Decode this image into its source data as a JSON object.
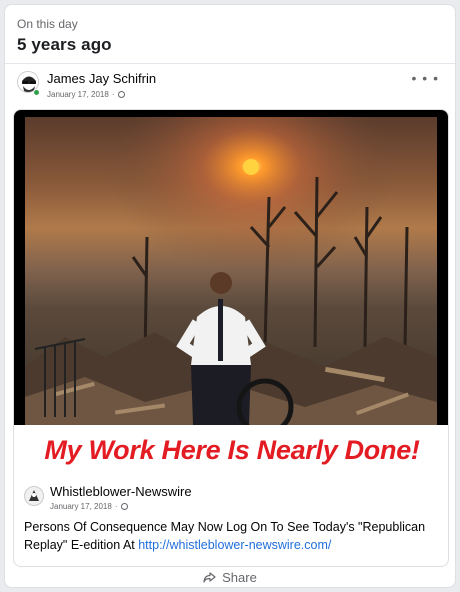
{
  "memory": {
    "eyebrow": "On this day",
    "title": "5 years ago"
  },
  "post": {
    "author": "James Jay Schifrin",
    "date": "January 17, 2018",
    "privacy_icon": "globe-icon",
    "more_icon": "more-icon"
  },
  "shared": {
    "image_caption": "My Work Here Is Nearly Done!",
    "author": "Whistleblower-Newswire",
    "date": "January 17, 2018",
    "body_text": "Persons Of Consequence May Now Log On To See Today's \"Republican Replay\" E-edition At ",
    "link_text": "http://whistleblower-newswire.com/"
  },
  "actions": {
    "share_label": "Share",
    "share_icon": "share-icon"
  },
  "colors": {
    "caption_red": "#e31b23",
    "link_blue": "#216fdb",
    "online_green": "#31a24c"
  }
}
